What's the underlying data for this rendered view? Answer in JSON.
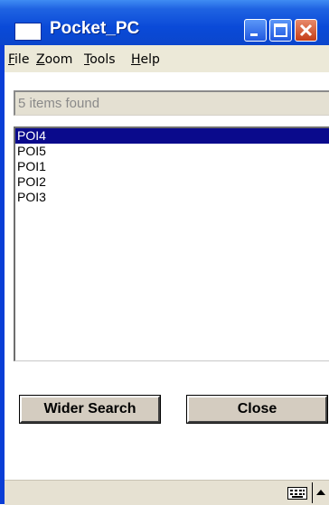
{
  "window": {
    "title": "Pocket_PC"
  },
  "menu": {
    "items": [
      "File",
      "Zoom",
      "Tools",
      "Help"
    ]
  },
  "search": {
    "status": "5 items found"
  },
  "results": {
    "items": [
      "POI4",
      "POI5",
      "POI1",
      "POI2",
      "POI3"
    ],
    "selected": "POI4"
  },
  "buttons": {
    "wider_search": "Wider Search",
    "close": "Close"
  },
  "taskbar": {
    "icons": [
      "keyboard-icon",
      "input-menu-arrow-icon"
    ]
  },
  "colors": {
    "titlebar": "#0a4ad8",
    "selection": "#0a0a8c",
    "window_bg": "#ece9d8"
  }
}
